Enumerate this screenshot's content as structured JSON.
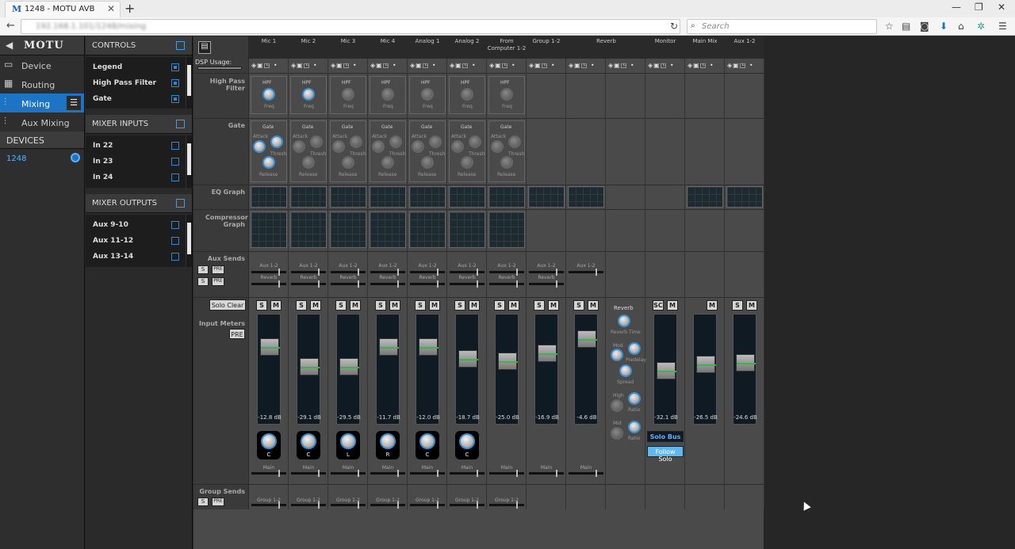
{
  "browser": {
    "tab_title": "1248 - MOTU AVB",
    "favicon": "M",
    "url": "192.168.1.101/1248/mixing",
    "search_placeholder": "Search"
  },
  "nav": {
    "brand": "MOTU",
    "items": [
      {
        "label": "Device",
        "icon": "device-icon"
      },
      {
        "label": "Routing",
        "icon": "routing-grid-icon"
      },
      {
        "label": "Mixing",
        "icon": "mixer-sliders-icon"
      },
      {
        "label": "Aux Mixing",
        "icon": "aux-mixer-icon"
      }
    ],
    "devices_header": "DEVICES",
    "device": "1248"
  },
  "panel": {
    "controls_header": "CONTROLS",
    "controls": [
      "Legend",
      "High Pass Filter",
      "Gate"
    ],
    "inputs_header": "MIXER INPUTS",
    "inputs": [
      "In 22",
      "In 23",
      "In 24"
    ],
    "outputs_header": "MIXER OUTPUTS",
    "outputs": [
      "Aux 9-10",
      "Aux 11-12",
      "Aux 13-14"
    ]
  },
  "mixer": {
    "dsp_label": "DSP Usage:",
    "row_labels": {
      "hpf": "High Pass Filter",
      "gate": "Gate",
      "eq": "EQ Graph",
      "comp": "Compressor Graph",
      "aux": "Aux Sends",
      "input_meters": "Input Meters",
      "group": "Group Sends"
    },
    "solo_clear": "Solo Clear",
    "pre": "PRE",
    "s": "S",
    "m": "M",
    "sc": "SC",
    "hpf_label": "HPF",
    "freq": "Freq",
    "gate_label": "Gate",
    "attack": "Attack",
    "thresh": "Thresh",
    "release": "Release",
    "aux_label": "Aux 1-2",
    "reverb_label": "Reverb",
    "main_label": "Main",
    "group_label": "Group 1-2",
    "channels": [
      {
        "name": "Mic 1",
        "db": "-12.8 dB",
        "pan": "C"
      },
      {
        "name": "Mic 2",
        "db": "-29.1 dB",
        "pan": "C"
      },
      {
        "name": "Mic 3",
        "db": "-29.5 dB",
        "pan": "L"
      },
      {
        "name": "Mic 4",
        "db": "-11.7 dB",
        "pan": "R"
      },
      {
        "name": "Analog 1",
        "db": "-12.0 dB",
        "pan": "C"
      },
      {
        "name": "Analog 2",
        "db": "-18.7 dB",
        "pan": "C"
      },
      {
        "name": "From Computer 1-2",
        "db": "-25.0 dB",
        "pan": ""
      },
      {
        "name": "Group 1-2",
        "db": "-16.9 dB",
        "pan": ""
      },
      {
        "name": "",
        "db": "-4.6 dB",
        "pan": ""
      },
      {
        "name": "Reverb",
        "db": "",
        "pan": ""
      },
      {
        "name": "Monitor",
        "db": "-32.1 dB",
        "pan": ""
      },
      {
        "name": "Main Mix",
        "db": "-26.5 dB",
        "pan": ""
      },
      {
        "name": "Aux 1-2",
        "db": "-24.6 dB",
        "pan": ""
      }
    ],
    "reverb": {
      "title": "Reverb",
      "reverb_time": "Reverb Time",
      "mod": "Mod",
      "predelay": "Predelay",
      "spread": "Spread",
      "high": "High",
      "ratio": "Ratio",
      "mid": "Mid"
    },
    "solo_bus": "Solo Bus",
    "follow_solo": "Follow Solo"
  },
  "colors": {
    "accent": "#1e74c4",
    "meter_green": "#3db34a"
  }
}
